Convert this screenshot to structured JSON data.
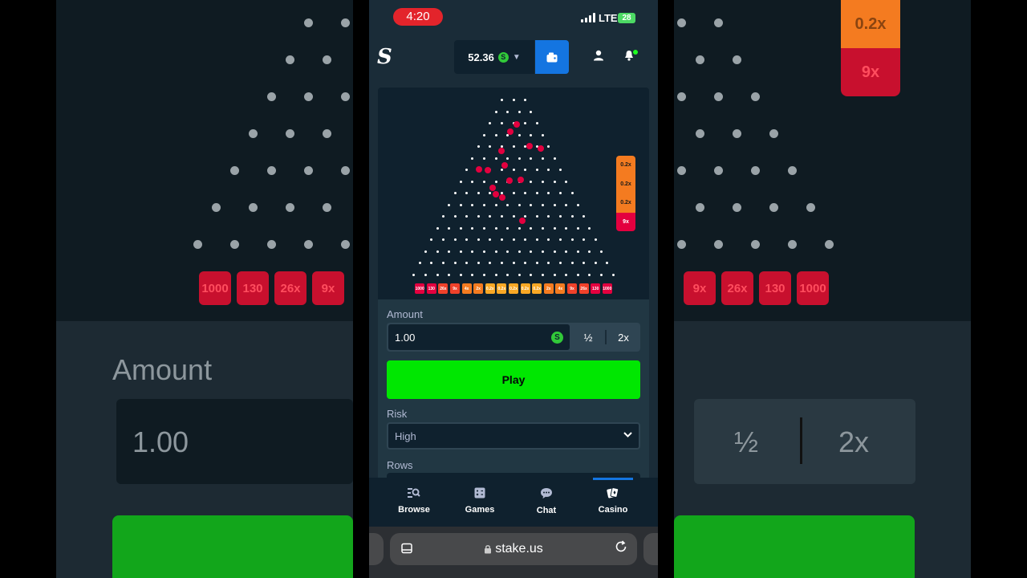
{
  "status": {
    "time": "4:20",
    "network": "LTE",
    "battery": "28"
  },
  "header": {
    "logo": "S",
    "balance": "52.36",
    "currency_symbol": "S"
  },
  "board": {
    "slots": [
      "1000",
      "130",
      "26x",
      "9x",
      "4x",
      "2x",
      "0.2x",
      "0.2x",
      "0.2x",
      "0.2x",
      "0.2x",
      "2x",
      "4x",
      "9x",
      "26x",
      "130",
      "1000"
    ],
    "recent_results": [
      "0.2x",
      "0.2x",
      "0.2x",
      "9x"
    ]
  },
  "controls": {
    "amount_label": "Amount",
    "amount_value": "1.00",
    "amount_coin": "S",
    "half_label": "½",
    "double_label": "2x",
    "play_label": "Play",
    "risk_label": "Risk",
    "risk_value": "High",
    "rows_label": "Rows"
  },
  "tabbar": {
    "items": [
      {
        "label": "Browse",
        "icon": "search-list-icon"
      },
      {
        "label": "Games",
        "icon": "dice-icon"
      },
      {
        "label": "Chat",
        "icon": "chat-bubble-icon"
      },
      {
        "label": "Casino",
        "icon": "cards-icon"
      }
    ]
  },
  "browser": {
    "url": "stake.us"
  },
  "background": {
    "amount_label": "Amount",
    "amount_value": "1.00",
    "half_label": "½",
    "double_label": "2x",
    "slots_left": [
      "1000",
      "130",
      "26x",
      "9x"
    ],
    "slots_right": [
      "9x",
      "26x",
      "130",
      "1000"
    ],
    "ladder": [
      "0.2x",
      "9x"
    ]
  },
  "colors": {
    "accent": "#1475e1",
    "play": "#00e701",
    "slot_red": "#e3003f",
    "slot_orange": "#f47b20",
    "slot_yellow": "#f9a825",
    "panel": "#213743",
    "board": "#0f212e"
  }
}
